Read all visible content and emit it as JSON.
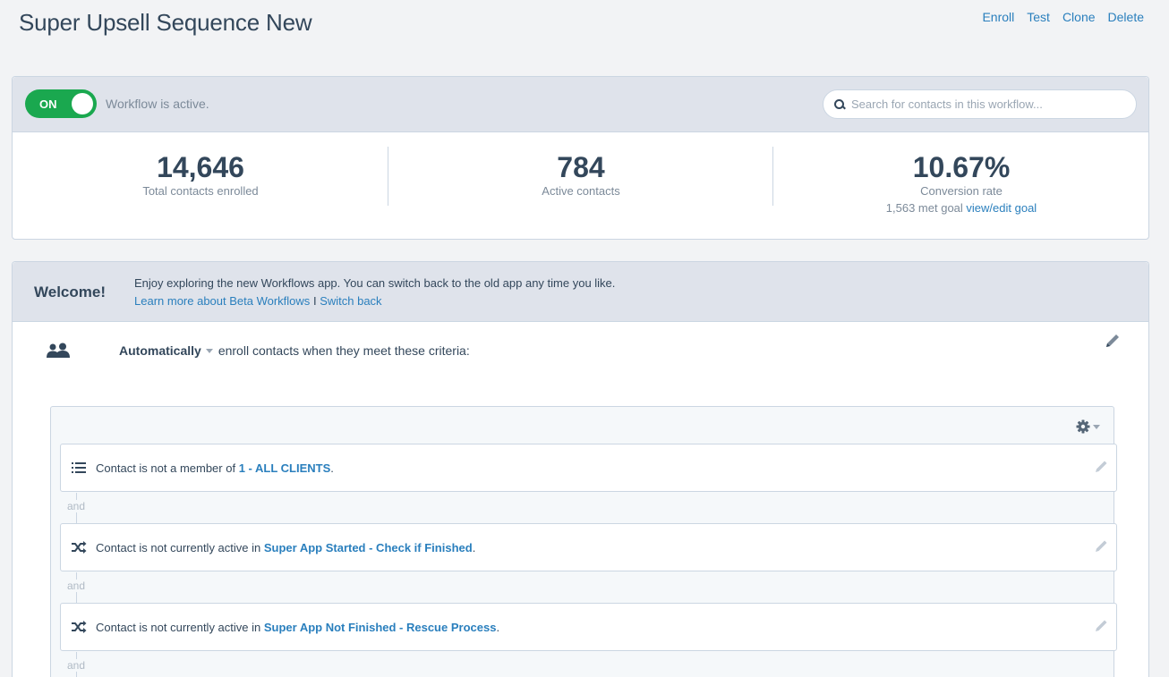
{
  "page": {
    "title": "Super Upsell Sequence New",
    "actions": [
      "Enroll",
      "Test",
      "Clone",
      "Delete"
    ]
  },
  "status": {
    "toggle_label": "ON",
    "toggle_state": true,
    "text": "Workflow is active.",
    "search_placeholder": "Search for contacts in this workflow..."
  },
  "stats": {
    "total": {
      "value": "14,646",
      "label": "Total contacts enrolled"
    },
    "active": {
      "value": "784",
      "label": "Active contacts"
    },
    "conversion": {
      "value": "10.67%",
      "label": "Conversion rate",
      "met_goal": "1,563 met goal",
      "goal_link": "view/edit goal"
    }
  },
  "welcome": {
    "title": "Welcome!",
    "message": "Enjoy exploring the new Workflows app. You can switch back to the old app any time you like.",
    "learn_more": "Learn more about Beta Workflows",
    "separator": "I",
    "switch_back": "Switch back"
  },
  "trigger": {
    "mode": "Automatically",
    "text": "enroll contacts when they meet these criteria:"
  },
  "criteria": [
    {
      "icon": "list-icon",
      "prefix": "Contact is not a member of ",
      "link": "1 - ALL CLIENTS",
      "suffix": "."
    },
    {
      "icon": "shuffle-icon",
      "prefix": "Contact is not currently active in ",
      "link": "Super App Started - Check if Finished",
      "suffix": "."
    },
    {
      "icon": "shuffle-icon",
      "prefix": "Contact is not currently active in ",
      "link": "Super App Not Finished - Rescue Process",
      "suffix": "."
    }
  ],
  "connector": "and",
  "colors": {
    "accent": "#2a7fbd",
    "toggle_on": "#1aa84f",
    "header_bg": "#dfe3eb"
  }
}
